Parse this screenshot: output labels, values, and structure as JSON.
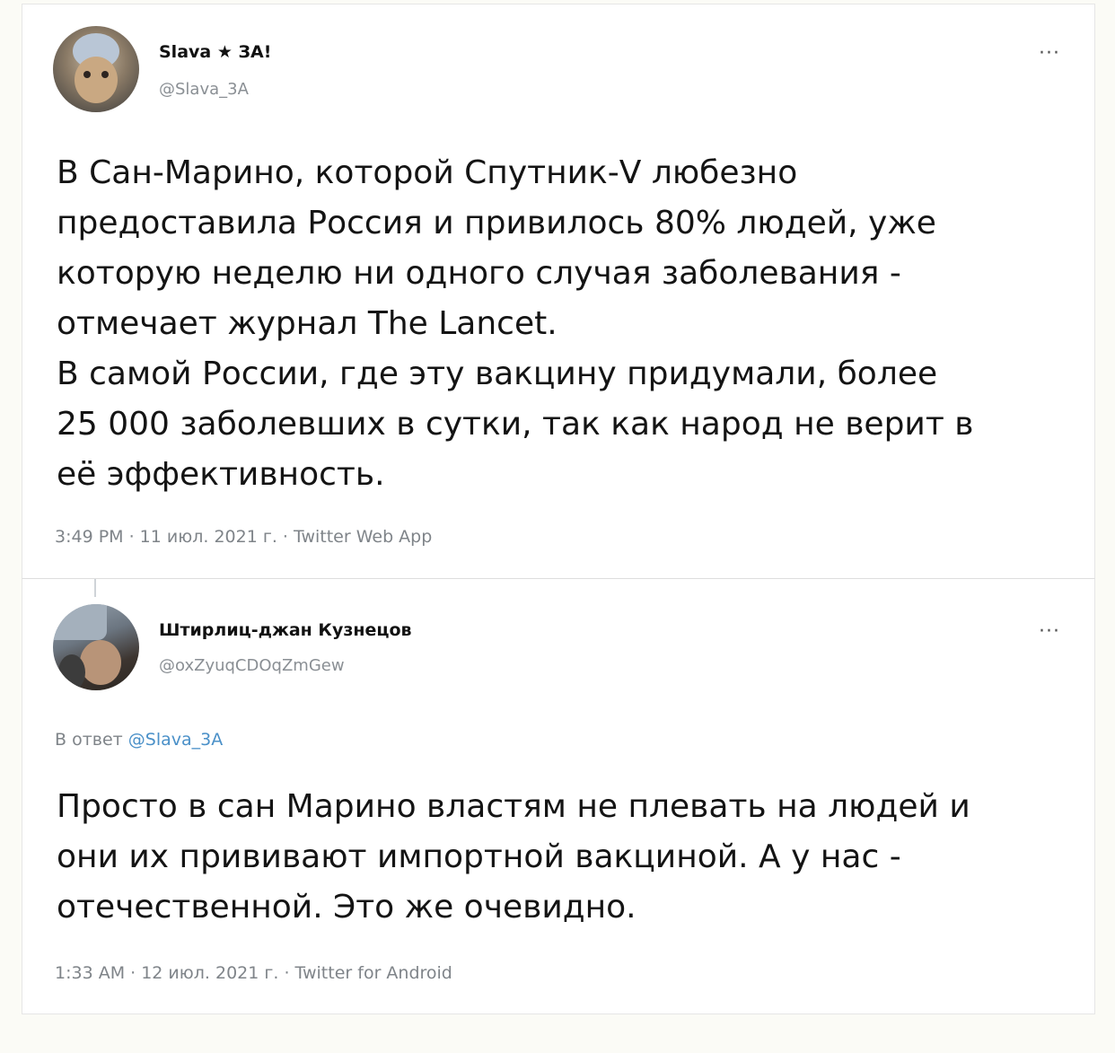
{
  "tweets": [
    {
      "author_name": "Slava ★ ЗА!",
      "author_handle": "@Slava_3A",
      "more_icon": "more-icon",
      "text": "В Сан-Марино, которой Спутник-V любезно\nпредоставила Россия и привилось 80% людей, уже\nкоторую неделю ни одного случая заболевания -\nотмечает журнал The Lancet.\nВ самой России, где эту вакцину придумали, более\n25 000 заболевших в сутки, так как народ не верит в\nеё эффективность.",
      "meta": "3:49 PM · 11 июл. 2021 г. · Twitter Web App"
    },
    {
      "author_name": "Штирлиц-джан Кузнецов",
      "author_handle": "@oxZyuqCDOqZmGew",
      "more_icon": "more-icon",
      "reply_prefix": "В ответ",
      "reply_handle": "@Slava_3A",
      "text": "Просто в сан Марино властям не плевать на людей и\nони их прививают импортной вакциной. А у нас -\nотечественной. Это же очевидно.",
      "meta": "1:33 AM · 12 июл. 2021 г. · Twitter for Android"
    }
  ],
  "more_label": "···",
  "colors": {
    "background": "#fbfbf6",
    "card": "#ffffff",
    "text": "#141414",
    "muted": "#7f8489",
    "link": "#4a90c8"
  }
}
